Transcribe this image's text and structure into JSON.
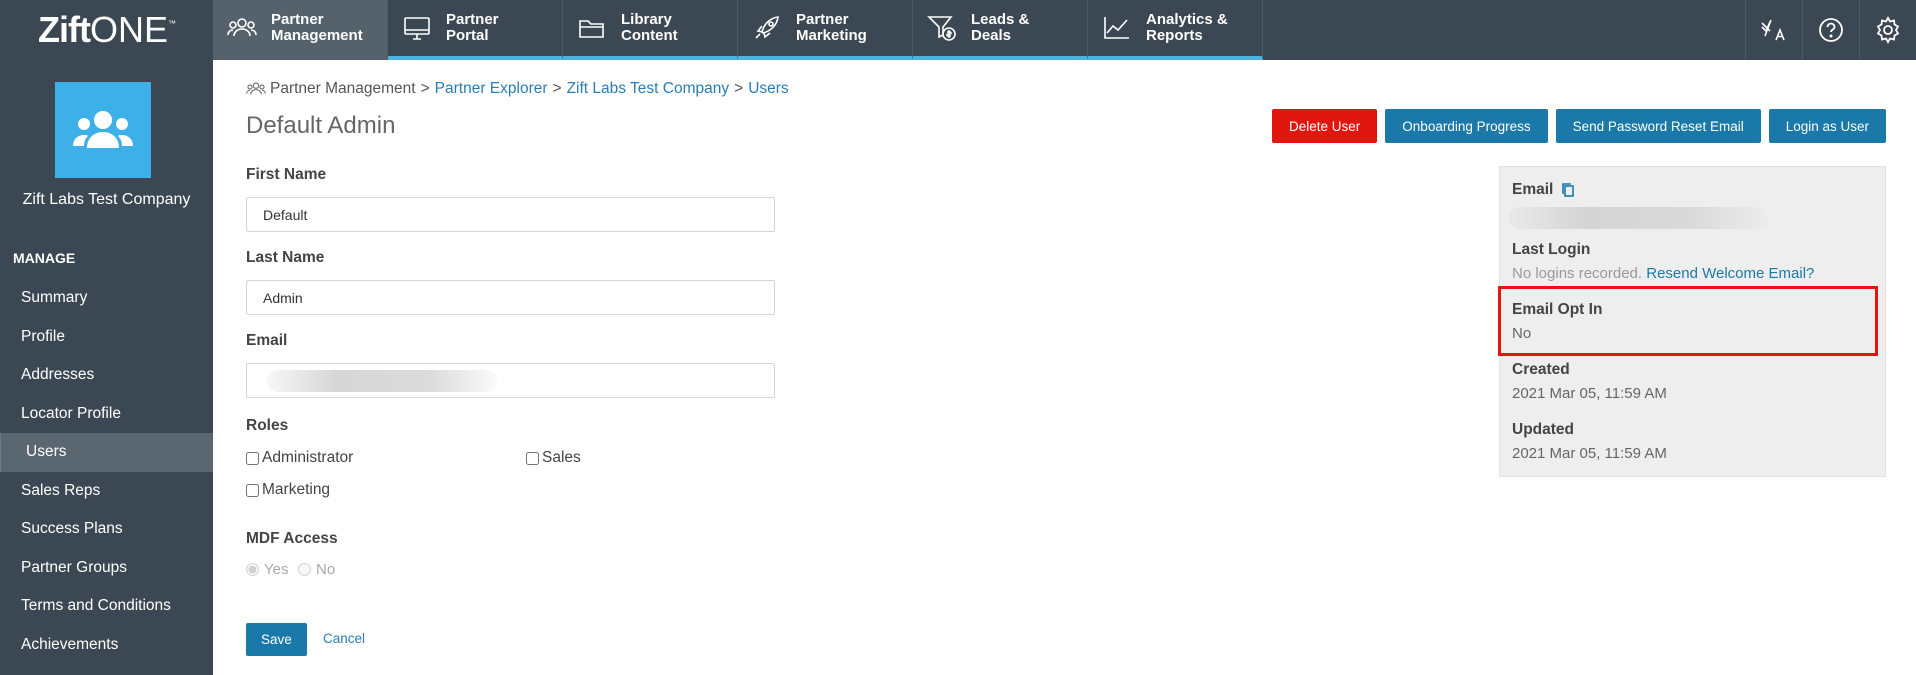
{
  "app": {
    "logo_main": "Zift",
    "logo_suffix": "ONE",
    "logo_tm": "™"
  },
  "nav": [
    {
      "label1": "Partner",
      "label2": "Management",
      "icon": "users-icon"
    },
    {
      "label1": "Partner",
      "label2": "Portal",
      "icon": "monitor-icon"
    },
    {
      "label1": "Library",
      "label2": "Content",
      "icon": "folder-icon"
    },
    {
      "label1": "Partner",
      "label2": "Marketing",
      "icon": "rocket-icon"
    },
    {
      "label1": "Leads &",
      "label2": "Deals",
      "icon": "funnel-dollar-icon"
    },
    {
      "label1": "Analytics &",
      "label2": "Reports",
      "icon": "line-chart-icon"
    }
  ],
  "top_right_icons": [
    "translate-icon",
    "help-icon",
    "gear-icon"
  ],
  "sidebar": {
    "company_name": "Zift Labs Test Company",
    "section": "MANAGE",
    "items": [
      "Summary",
      "Profile",
      "Addresses",
      "Locator Profile",
      "Users",
      "Sales Reps",
      "Success Plans",
      "Partner Groups",
      "Terms and Conditions",
      "Achievements"
    ],
    "active": "Users"
  },
  "breadcrumb": {
    "root": "Partner Management",
    "links": [
      "Partner Explorer",
      "Zift Labs Test Company",
      "Users"
    ],
    "sep": ">"
  },
  "page": {
    "title": "Default Admin"
  },
  "actions": {
    "delete": "Delete User",
    "onboarding": "Onboarding Progress",
    "reset": "Send Password Reset Email",
    "login_as": "Login as User"
  },
  "form": {
    "first_name_label": "First Name",
    "first_name_value": "Default",
    "last_name_label": "Last Name",
    "last_name_value": "Admin",
    "email_label": "Email",
    "roles_label": "Roles",
    "roles": {
      "administrator": "Administrator",
      "sales": "Sales",
      "marketing": "Marketing"
    },
    "mdf_label": "MDF Access",
    "mdf_yes": "Yes",
    "mdf_no": "No",
    "save": "Save",
    "cancel": "Cancel"
  },
  "info_panel": {
    "email_label": "Email",
    "last_login_label": "Last Login",
    "last_login_value": "No logins recorded.",
    "resend_link": "Resend Welcome Email?",
    "opt_in_label": "Email Opt In",
    "opt_in_value": "No",
    "created_label": "Created",
    "created_value": "2021 Mar 05, 11:59 AM",
    "updated_label": "Updated",
    "updated_value": "2021 Mar 05, 11:59 AM"
  },
  "colors": {
    "topbar": "#3b4752",
    "accent": "#4ab3e0",
    "primary": "#1a79a8",
    "danger": "#e0160f"
  }
}
